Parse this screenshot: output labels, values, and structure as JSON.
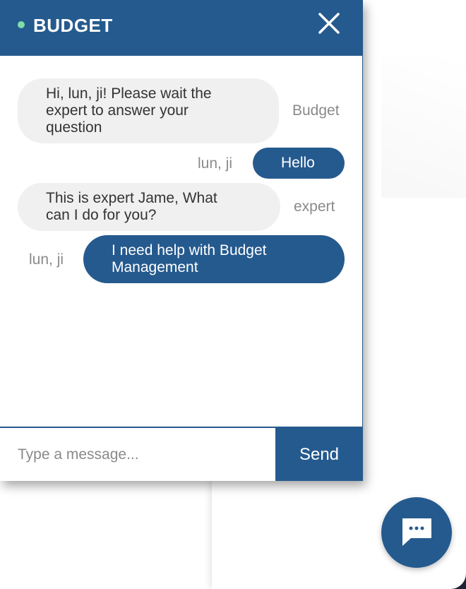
{
  "header": {
    "title": "BUDGET",
    "status": "online"
  },
  "messages": [
    {
      "direction": "incoming",
      "sender": "Budget",
      "text": [
        "Hi, lun, ji! Please wait the",
        "expert to answer your",
        "question"
      ]
    },
    {
      "direction": "outgoing",
      "sender": "lun, ji",
      "text": [
        "Hello"
      ]
    },
    {
      "direction": "incoming",
      "sender": "expert",
      "text": [
        "This is expert Jame, What",
        "can I do for you?"
      ]
    },
    {
      "direction": "outgoing",
      "sender": "lun, ji",
      "text": [
        "I need help with Budget",
        "Management"
      ]
    }
  ],
  "composer": {
    "placeholder": "Type a message...",
    "value": "",
    "send_label": "Send"
  },
  "icons": {
    "close": "close-icon",
    "launcher": "chat-bubble-icon"
  },
  "colors": {
    "primary": "#255a8e",
    "incoming_bubble": "#f0f0f0",
    "status_dot": "#7fdda7",
    "sender_text": "#8a8a8a"
  }
}
